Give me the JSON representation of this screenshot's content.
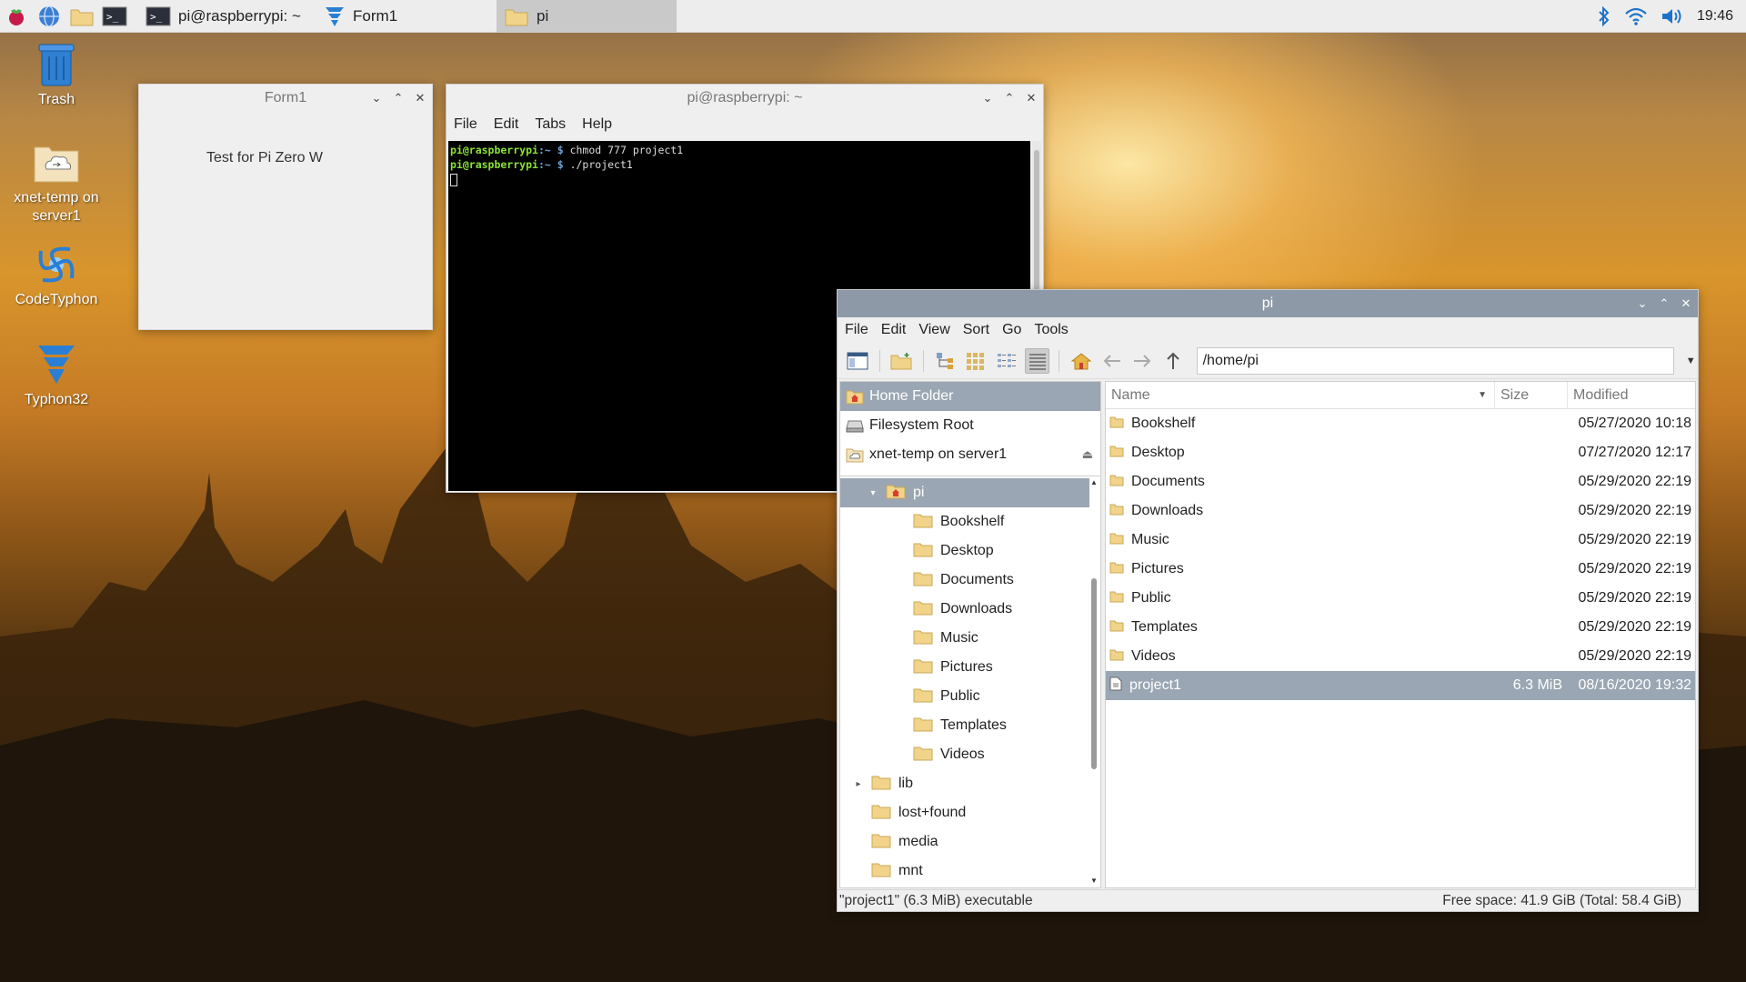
{
  "taskbar": {
    "launchers": [
      "raspberry-menu-icon",
      "web-browser-icon",
      "file-manager-icon",
      "terminal-icon"
    ],
    "tasks": [
      {
        "label": "pi@raspberrypi: ~",
        "icon": "terminal-icon",
        "active": false
      },
      {
        "label": "Form1",
        "icon": "codetyphon-icon",
        "active": false
      },
      {
        "label": "pi",
        "icon": "folder-icon",
        "active": true
      }
    ],
    "tray": [
      "bluetooth-icon",
      "wifi-icon",
      "volume-icon"
    ],
    "clock": "19:46"
  },
  "desktop": {
    "icons": [
      {
        "label": "Trash",
        "icon": "trash-icon"
      },
      {
        "label": "xnet-temp on server1",
        "icon": "network-share-icon"
      },
      {
        "label": "CodeTyphon",
        "icon": "codetyphon-icon"
      },
      {
        "label": "Typhon32",
        "icon": "typhon32-icon"
      }
    ]
  },
  "form1": {
    "title": "Form1",
    "label": "Test for Pi Zero W"
  },
  "terminal": {
    "title": "pi@raspberrypi: ~",
    "menu": [
      "File",
      "Edit",
      "Tabs",
      "Help"
    ],
    "lines": [
      {
        "user": "pi@raspberrypi",
        "path": ":~",
        "sym": " $ ",
        "cmd": "chmod 777 project1"
      },
      {
        "user": "pi@raspberrypi",
        "path": ":~",
        "sym": " $ ",
        "cmd": "./project1"
      }
    ]
  },
  "file_manager": {
    "title": "pi",
    "menu": [
      "File",
      "Edit",
      "View",
      "Sort",
      "Go",
      "Tools"
    ],
    "path": "/home/pi",
    "places": [
      {
        "label": "Home Folder",
        "selected": true
      },
      {
        "label": "Filesystem Root"
      },
      {
        "label": "xnet-temp on server1"
      }
    ],
    "tree": [
      {
        "label": "pi",
        "depth": 1,
        "expander": "▾",
        "selected": true
      },
      {
        "label": "Bookshelf",
        "depth": 2
      },
      {
        "label": "Desktop",
        "depth": 2
      },
      {
        "label": "Documents",
        "depth": 2
      },
      {
        "label": "Downloads",
        "depth": 2
      },
      {
        "label": "Music",
        "depth": 2
      },
      {
        "label": "Pictures",
        "depth": 2
      },
      {
        "label": "Public",
        "depth": 2
      },
      {
        "label": "Templates",
        "depth": 2
      },
      {
        "label": "Videos",
        "depth": 2
      },
      {
        "label": "lib",
        "depth": 0,
        "expander": "▸"
      },
      {
        "label": "lost+found",
        "depth": 0
      },
      {
        "label": "media",
        "depth": 0
      },
      {
        "label": "mnt",
        "depth": 0
      }
    ],
    "columns": {
      "name": "Name",
      "size": "Size",
      "modified": "Modified"
    },
    "files": [
      {
        "name": "Bookshelf",
        "size": "",
        "modified": "05/27/2020 10:18",
        "type": "folder"
      },
      {
        "name": "Desktop",
        "size": "",
        "modified": "07/27/2020 12:17",
        "type": "folder"
      },
      {
        "name": "Documents",
        "size": "",
        "modified": "05/29/2020 22:19",
        "type": "folder"
      },
      {
        "name": "Downloads",
        "size": "",
        "modified": "05/29/2020 22:19",
        "type": "folder"
      },
      {
        "name": "Music",
        "size": "",
        "modified": "05/29/2020 22:19",
        "type": "folder"
      },
      {
        "name": "Pictures",
        "size": "",
        "modified": "05/29/2020 22:19",
        "type": "folder"
      },
      {
        "name": "Public",
        "size": "",
        "modified": "05/29/2020 22:19",
        "type": "folder"
      },
      {
        "name": "Templates",
        "size": "",
        "modified": "05/29/2020 22:19",
        "type": "folder"
      },
      {
        "name": "Videos",
        "size": "",
        "modified": "05/29/2020 22:19",
        "type": "folder"
      },
      {
        "name": "project1",
        "size": "6.3 MiB",
        "modified": "08/16/2020 19:32",
        "type": "executable",
        "selected": true
      }
    ],
    "status_left": "\"project1\" (6.3 MiB) executable",
    "status_right": "Free space: 41.9 GiB (Total: 58.4 GiB)"
  }
}
